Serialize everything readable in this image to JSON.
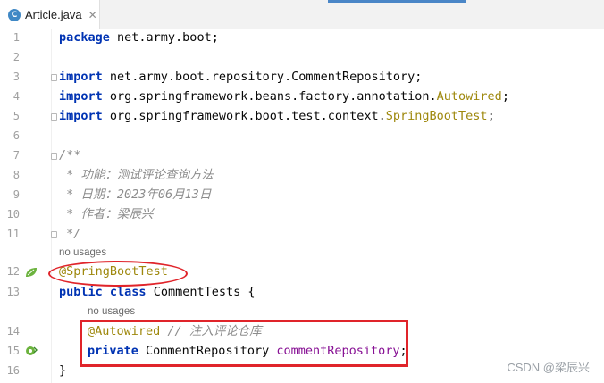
{
  "tab": {
    "file_icon_letter": "C",
    "filename": "Article.java",
    "close_glyph": "✕"
  },
  "gutter": {
    "line_numbers": [
      "1",
      "2",
      "3",
      "4",
      "5",
      "6",
      "7",
      "8",
      "9",
      "10",
      "11",
      "12",
      "13",
      "14",
      "15",
      "16"
    ]
  },
  "code": {
    "l1": {
      "kw": "package",
      "rest": " net.army.boot;"
    },
    "l3": {
      "kw": "import",
      "rest": " net.army.boot.repository.CommentRepository;"
    },
    "l4": {
      "kw": "import",
      "rest": " org.springframework.beans.factory.annotation.",
      "ann": "Autowired",
      "end": ";"
    },
    "l5": {
      "kw": "import",
      "rest": " org.springframework.boot.test.context.",
      "ann": "SpringBootTest",
      "end": ";"
    },
    "l7": "/**",
    "l8": " * 功能：测试评论查询方法",
    "l9": " * 日期：2023年06月13日",
    "l10": " * 作者：梁辰兴",
    "l11": " */",
    "hint1": "no usages",
    "l12": "@SpringBootTest",
    "l13": {
      "kw1": "public",
      "kw2": "class",
      "rest": " CommentTests {"
    },
    "hint2": "no usages",
    "l14": {
      "ann": "@Autowired",
      "cm": " // 注入评论仓库"
    },
    "l15": {
      "kw": "private",
      "type": " CommentRepository ",
      "fld": "commentRepository",
      "end": ";"
    },
    "l16": "}"
  },
  "watermark": "CSDN @梁辰兴",
  "colors": {
    "keyword": "#0033b3",
    "annotation": "#9e880d",
    "comment": "#8c8c8c",
    "field": "#871094",
    "highlight_red": "#e0242a",
    "spring_green": "#6cb33e"
  },
  "icons": {
    "file": "java-class-icon",
    "gutter_line12": "spring-bean-icon",
    "gutter_line15": "spring-autowired-icon"
  }
}
